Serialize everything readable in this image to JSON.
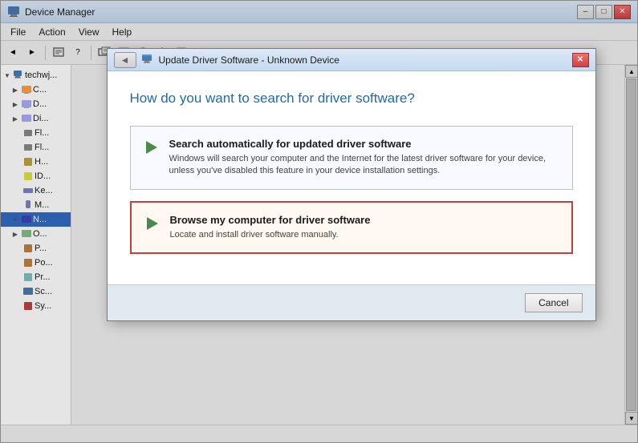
{
  "app": {
    "title": "Device Manager",
    "icon": "🖥"
  },
  "title_bar": {
    "buttons": {
      "minimize": "–",
      "maximize": "□",
      "close": "✕"
    }
  },
  "menu": {
    "items": [
      "File",
      "Action",
      "View",
      "Help"
    ]
  },
  "toolbar": {
    "buttons": [
      "◄",
      "►",
      "⇪",
      "🔍",
      "?",
      "⊞",
      "⊟",
      "⊠",
      "⊡",
      "⬛",
      "⬜",
      "▶",
      "⏹"
    ]
  },
  "tree": {
    "root": "techwj...",
    "items": [
      {
        "label": "C...",
        "level": 1,
        "has_children": true
      },
      {
        "label": "D...",
        "level": 1,
        "has_children": true
      },
      {
        "label": "D...",
        "level": 1,
        "has_children": true
      },
      {
        "label": "Fl...",
        "level": 1,
        "has_children": false
      },
      {
        "label": "Fl...",
        "level": 1,
        "has_children": false
      },
      {
        "label": "H...",
        "level": 1,
        "has_children": false
      },
      {
        "label": "ID...",
        "level": 1,
        "has_children": false
      },
      {
        "label": "Ke...",
        "level": 1,
        "has_children": false
      },
      {
        "label": "M...",
        "level": 1,
        "has_children": false
      },
      {
        "label": "N...",
        "level": 1,
        "has_children": true,
        "selected": true
      },
      {
        "label": "O...",
        "level": 1,
        "has_children": true
      },
      {
        "label": "P...",
        "level": 1,
        "has_children": false
      },
      {
        "label": "P...",
        "level": 1,
        "has_children": false
      },
      {
        "label": "Pr...",
        "level": 1,
        "has_children": false
      },
      {
        "label": "Sc...",
        "level": 1,
        "has_children": false
      },
      {
        "label": "Sy...",
        "level": 1,
        "has_children": false
      }
    ]
  },
  "dialog": {
    "title": "Update Driver Software - Unknown Device",
    "heading": "How do you want to search for driver software?",
    "back_btn": "◄",
    "close_btn": "✕",
    "options": [
      {
        "title": "Search automatically for updated driver software",
        "description": "Windows will search your computer and the Internet for the latest driver software for your device, unless you've disabled this feature in your device installation settings.",
        "highlighted": false
      },
      {
        "title": "Browse my computer for driver software",
        "description": "Locate and install driver software manually.",
        "highlighted": true
      }
    ],
    "cancel_label": "Cancel"
  }
}
